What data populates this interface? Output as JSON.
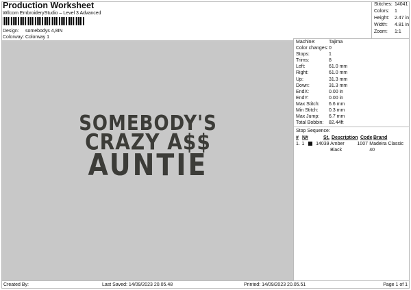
{
  "header": {
    "title": "Production Worksheet",
    "subtitle": "Wilcom EmbroideryStudio – Level 3 Advanced",
    "design_label": "Design:",
    "design_value": "somebodys 4,8IN",
    "colorway_label": "Colorway:",
    "colorway_value": "Colorway 1"
  },
  "stats": [
    {
      "k": "Stitches:",
      "v": "14041"
    },
    {
      "k": "Colors:",
      "v": "1"
    },
    {
      "k": "Height:",
      "v": "2.47 in"
    },
    {
      "k": "Width:",
      "v": "4.81 in"
    },
    {
      "k": "Zoom:",
      "v": "1:1"
    }
  ],
  "info": [
    {
      "k": "Machine:",
      "v": "Tajima"
    },
    {
      "k": "Color changes:",
      "v": "0"
    },
    {
      "k": "Stops:",
      "v": "1"
    },
    {
      "k": "Trims:",
      "v": "8"
    },
    {
      "k": "Left:",
      "v": "61.0 mm"
    },
    {
      "k": "Right:",
      "v": "61.0 mm"
    },
    {
      "k": "Up:",
      "v": "31.3 mm"
    },
    {
      "k": "Down:",
      "v": "31.3 mm"
    },
    {
      "k": "EndX:",
      "v": "0.00 in"
    },
    {
      "k": "EndY:",
      "v": "0.00 in"
    },
    {
      "k": "Max Stitch:",
      "v": "6.6 mm"
    },
    {
      "k": "Min Stitch:",
      "v": "0.3 mm"
    },
    {
      "k": "Max Jump:",
      "v": "6.7 mm"
    },
    {
      "k": "Total Bobbin:",
      "v": "82.44ft"
    }
  ],
  "stop_sequence": {
    "label": "Stop Sequence:",
    "headers": [
      "#",
      "N#",
      "St.",
      "Description",
      "Code",
      "Brand"
    ],
    "rows": [
      {
        "num": "1.",
        "n": "1",
        "st": "14039",
        "desc": "Amber Black",
        "code": "1007",
        "brand": "Madeira Classic 40",
        "color": "#111111"
      }
    ]
  },
  "design_art": {
    "line1": "SOMEBODY'S",
    "line2": "CRAZY A$$",
    "line3": "AUNTIE"
  },
  "footer": {
    "created": "Created By:",
    "saved": "Last Saved: 14/09/2023 20.05.48",
    "printed": "Printed: 14/09/2023 20.05.51",
    "page": "Page 1 of 1"
  }
}
